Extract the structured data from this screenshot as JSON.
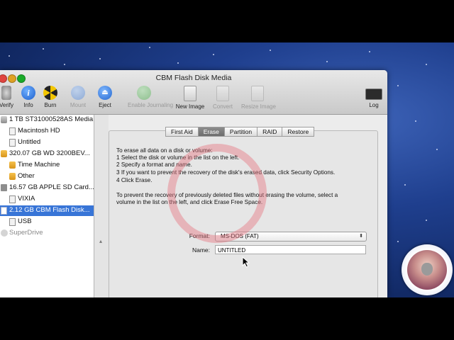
{
  "window": {
    "title": "CBM Flash Disk Media"
  },
  "toolbar": {
    "items": [
      {
        "label": "Verify",
        "icon": "microscope-icon",
        "enabled": true
      },
      {
        "label": "Info",
        "icon": "info-icon",
        "enabled": true
      },
      {
        "label": "Burn",
        "icon": "burn-icon",
        "enabled": true
      },
      {
        "label": "Mount",
        "icon": "mount-icon",
        "enabled": false
      },
      {
        "label": "Eject",
        "icon": "eject-icon",
        "enabled": true
      },
      {
        "label": "Enable Journaling",
        "icon": "journaling-icon",
        "enabled": false
      },
      {
        "label": "New Image",
        "icon": "new-image-icon",
        "enabled": true
      },
      {
        "label": "Convert",
        "icon": "convert-icon",
        "enabled": false
      },
      {
        "label": "Resize Image",
        "icon": "resize-image-icon",
        "enabled": false
      },
      {
        "label": "Log",
        "icon": "log-icon",
        "enabled": true
      }
    ]
  },
  "sidebar": {
    "items": [
      {
        "label": "1 TB ST31000528AS Media",
        "type": "drive"
      },
      {
        "label": "Macintosh HD",
        "type": "volume"
      },
      {
        "label": "Untitled",
        "type": "volume"
      },
      {
        "label": "320.07 GB WD 3200BEV...",
        "type": "drive-external"
      },
      {
        "label": "Time Machine",
        "type": "volume-external"
      },
      {
        "label": "Other",
        "type": "volume-external"
      },
      {
        "label": "16.57 GB APPLE SD Card...",
        "type": "sd"
      },
      {
        "label": "VIXIA",
        "type": "volume"
      },
      {
        "label": "2.12 GB CBM Flash Disk...",
        "type": "flash",
        "selected": true
      },
      {
        "label": "USB",
        "type": "volume"
      },
      {
        "label": "SuperDrive",
        "type": "superdrive"
      }
    ]
  },
  "tabs": [
    {
      "label": "First Aid",
      "active": false
    },
    {
      "label": "Erase",
      "active": true
    },
    {
      "label": "Partition",
      "active": false
    },
    {
      "label": "RAID",
      "active": false
    },
    {
      "label": "Restore",
      "active": false
    }
  ],
  "erase": {
    "instructions": [
      "To erase all data on a disk or volume:",
      "1 Select the disk or volume in the list on the left.",
      "2 Specify a format and name.",
      "3 If you want to prevent the recovery of the disk's erased data, click Security Options.",
      "4 Click Erase.",
      "To prevent the recovery of previously deleted files without erasing the volume, select a",
      "volume in the list on the left, and click Erase Free Space."
    ],
    "format_label": "Format:",
    "format_value": "MS-DOS (FAT)",
    "name_label": "Name:",
    "name_value": "UNTITLED"
  },
  "colors": {
    "selection": "#3875d7",
    "desktop": "#1f3f8e",
    "highlight_ring": "#e67882"
  }
}
